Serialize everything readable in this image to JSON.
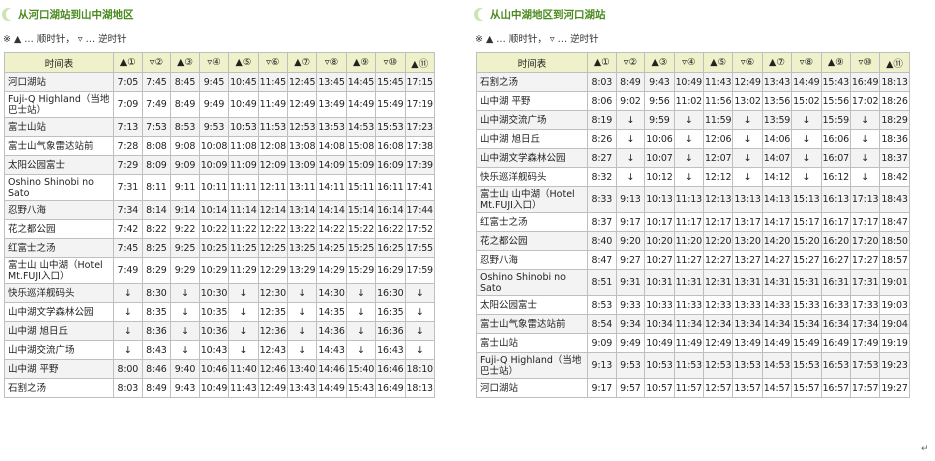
{
  "left": {
    "title": "从河口湖站到山中湖地区",
    "legend": "※ ▲ … 顺时针，  ▿ … 逆时针",
    "header_name": "时间表",
    "columns": [
      "▲①",
      "▿②",
      "▲③",
      "▿④",
      "▲⑤",
      "▿⑥",
      "▲⑦",
      "▿⑧",
      "▲⑨",
      "▿⑩",
      "▲⑪"
    ],
    "rows": [
      {
        "station": "河口湖站",
        "times": [
          "7:05",
          "7:45",
          "8:45",
          "9:45",
          "10:45",
          "11:45",
          "12:45",
          "13:45",
          "14:45",
          "15:45",
          "17:15"
        ]
      },
      {
        "station": "Fuji-Q Highland（当地巴士站）",
        "times": [
          "7:09",
          "7:49",
          "8:49",
          "9:49",
          "10:49",
          "11:49",
          "12:49",
          "13:49",
          "14:49",
          "15:49",
          "17:19"
        ]
      },
      {
        "station": "富士山站",
        "times": [
          "7:13",
          "7:53",
          "8:53",
          "9:53",
          "10:53",
          "11:53",
          "12:53",
          "13:53",
          "14:53",
          "15:53",
          "17:23"
        ]
      },
      {
        "station": "富士山气象雷达站前",
        "times": [
          "7:28",
          "8:08",
          "9:08",
          "10:08",
          "11:08",
          "12:08",
          "13:08",
          "14:08",
          "15:08",
          "16:08",
          "17:38"
        ]
      },
      {
        "station": "太阳公园富士",
        "times": [
          "7:29",
          "8:09",
          "9:09",
          "10:09",
          "11:09",
          "12:09",
          "13:09",
          "14:09",
          "15:09",
          "16:09",
          "17:39"
        ]
      },
      {
        "station": "Oshino Shinobi no Sato",
        "times": [
          "7:31",
          "8:11",
          "9:11",
          "10:11",
          "11:11",
          "12:11",
          "13:11",
          "14:11",
          "15:11",
          "16:11",
          "17:41"
        ]
      },
      {
        "station": "忍野八海",
        "times": [
          "7:34",
          "8:14",
          "9:14",
          "10:14",
          "11:14",
          "12:14",
          "13:14",
          "14:14",
          "15:14",
          "16:14",
          "17:44"
        ]
      },
      {
        "station": "花之都公园",
        "times": [
          "7:42",
          "8:22",
          "9:22",
          "10:22",
          "11:22",
          "12:22",
          "13:22",
          "14:22",
          "15:22",
          "16:22",
          "17:52"
        ]
      },
      {
        "station": "红富士之汤",
        "times": [
          "7:45",
          "8:25",
          "9:25",
          "10:25",
          "11:25",
          "12:25",
          "13:25",
          "14:25",
          "15:25",
          "16:25",
          "17:55"
        ]
      },
      {
        "station": "富士山 山中湖（Hotel Mt.FUJI入口）",
        "times": [
          "7:49",
          "8:29",
          "9:29",
          "10:29",
          "11:29",
          "12:29",
          "13:29",
          "14:29",
          "15:29",
          "16:29",
          "17:59"
        ]
      },
      {
        "station": "快乐巡洋舰码头",
        "times": [
          "↓",
          "8:30",
          "↓",
          "10:30",
          "↓",
          "12:30",
          "↓",
          "14:30",
          "↓",
          "16:30",
          "↓"
        ]
      },
      {
        "station": "山中湖文学森林公园",
        "times": [
          "↓",
          "8:35",
          "↓",
          "10:35",
          "↓",
          "12:35",
          "↓",
          "14:35",
          "↓",
          "16:35",
          "↓"
        ]
      },
      {
        "station": "山中湖 旭日丘",
        "times": [
          "↓",
          "8:36",
          "↓",
          "10:36",
          "↓",
          "12:36",
          "↓",
          "14:36",
          "↓",
          "16:36",
          "↓"
        ]
      },
      {
        "station": "山中湖交流广场",
        "times": [
          "↓",
          "8:43",
          "↓",
          "10:43",
          "↓",
          "12:43",
          "↓",
          "14:43",
          "↓",
          "16:43",
          "↓"
        ]
      },
      {
        "station": "山中湖 平野",
        "times": [
          "8:00",
          "8:46",
          "9:40",
          "10:46",
          "11:40",
          "12:46",
          "13:40",
          "14:46",
          "15:40",
          "16:46",
          "18:10"
        ]
      },
      {
        "station": "石割之汤",
        "times": [
          "8:03",
          "8:49",
          "9:43",
          "10:49",
          "11:43",
          "12:49",
          "13:43",
          "14:49",
          "15:43",
          "16:49",
          "18:13"
        ]
      }
    ]
  },
  "right": {
    "title": "从山中湖地区到河口湖站",
    "legend": "※ ▲ … 顺时针，  ▿ … 逆时针",
    "header_name": "时间表",
    "columns": [
      "▲①",
      "▿②",
      "▲③",
      "▿④",
      "▲⑤",
      "▿⑥",
      "▲⑦",
      "▿⑧",
      "▲⑨",
      "▿⑩",
      "▲⑪"
    ],
    "rows": [
      {
        "station": "石割之汤",
        "times": [
          "8:03",
          "8:49",
          "9:43",
          "10:49",
          "11:43",
          "12:49",
          "13:43",
          "14:49",
          "15:43",
          "16:49",
          "18:13"
        ]
      },
      {
        "station": "山中湖 平野",
        "times": [
          "8:06",
          "9:02",
          "9:56",
          "11:02",
          "11:56",
          "13:02",
          "13:56",
          "15:02",
          "15:56",
          "17:02",
          "18:26"
        ]
      },
      {
        "station": "山中湖交流广场",
        "times": [
          "8:19",
          "↓",
          "9:59",
          "↓",
          "11:59",
          "↓",
          "13:59",
          "↓",
          "15:59",
          "↓",
          "18:29"
        ]
      },
      {
        "station": "山中湖 旭日丘",
        "times": [
          "8:26",
          "↓",
          "10:06",
          "↓",
          "12:06",
          "↓",
          "14:06",
          "↓",
          "16:06",
          "↓",
          "18:36"
        ]
      },
      {
        "station": "山中湖文学森林公园",
        "times": [
          "8:27",
          "↓",
          "10:07",
          "↓",
          "12:07",
          "↓",
          "14:07",
          "↓",
          "16:07",
          "↓",
          "18:37"
        ]
      },
      {
        "station": "快乐巡洋舰码头",
        "times": [
          "8:32",
          "↓",
          "10:12",
          "↓",
          "12:12",
          "↓",
          "14:12",
          "↓",
          "16:12",
          "↓",
          "18:42"
        ]
      },
      {
        "station": "富士山 山中湖（Hotel Mt.FUJI入口）",
        "times": [
          "8:33",
          "9:13",
          "10:13",
          "11:13",
          "12:13",
          "13:13",
          "14:13",
          "15:13",
          "16:13",
          "17:13",
          "18:43"
        ]
      },
      {
        "station": "红富士之汤",
        "times": [
          "8:37",
          "9:17",
          "10:17",
          "11:17",
          "12:17",
          "13:17",
          "14:17",
          "15:17",
          "16:17",
          "17:17",
          "18:47"
        ]
      },
      {
        "station": "花之都公园",
        "times": [
          "8:40",
          "9:20",
          "10:20",
          "11:20",
          "12:20",
          "13:20",
          "14:20",
          "15:20",
          "16:20",
          "17:20",
          "18:50"
        ]
      },
      {
        "station": "忍野八海",
        "times": [
          "8:47",
          "9:27",
          "10:27",
          "11:27",
          "12:27",
          "13:27",
          "14:27",
          "15:27",
          "16:27",
          "17:27",
          "18:57"
        ]
      },
      {
        "station": "Oshino Shinobi no Sato",
        "times": [
          "8:51",
          "9:31",
          "10:31",
          "11:31",
          "12:31",
          "13:31",
          "14:31",
          "15:31",
          "16:31",
          "17:31",
          "19:01"
        ]
      },
      {
        "station": "太阳公园富士",
        "times": [
          "8:53",
          "9:33",
          "10:33",
          "11:33",
          "12:33",
          "13:33",
          "14:33",
          "15:33",
          "16:33",
          "17:33",
          "19:03"
        ]
      },
      {
        "station": "富士山气象雷达站前",
        "times": [
          "8:54",
          "9:34",
          "10:34",
          "11:34",
          "12:34",
          "13:34",
          "14:34",
          "15:34",
          "16:34",
          "17:34",
          "19:04"
        ]
      },
      {
        "station": "富士山站",
        "times": [
          "9:09",
          "9:49",
          "10:49",
          "11:49",
          "12:49",
          "13:49",
          "14:49",
          "15:49",
          "16:49",
          "17:49",
          "19:19"
        ]
      },
      {
        "station": "Fuji-Q Highland（当地巴士站）",
        "times": [
          "9:13",
          "9:53",
          "10:53",
          "11:53",
          "12:53",
          "13:53",
          "14:53",
          "15:53",
          "16:53",
          "17:53",
          "19:23"
        ]
      },
      {
        "station": "河口湖站",
        "times": [
          "9:17",
          "9:57",
          "10:57",
          "11:57",
          "12:57",
          "13:57",
          "14:57",
          "15:57",
          "16:57",
          "17:57",
          "19:27"
        ]
      }
    ]
  },
  "corner_mark": "↵"
}
